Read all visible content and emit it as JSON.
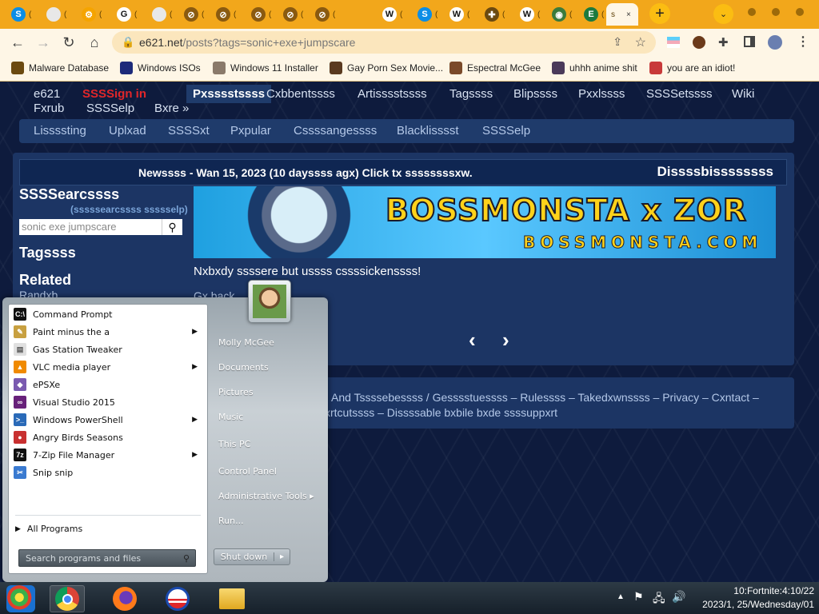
{
  "browser": {
    "tabs": [
      {
        "icon": "skype-icon",
        "color": "#0b8de6",
        "glyph": "S"
      },
      {
        "icon": "slides-icon",
        "color": "#e8e8e8",
        "glyph": ""
      },
      {
        "icon": "settings-icon",
        "color": "#f5a400",
        "glyph": "⚙"
      },
      {
        "icon": "google-icon",
        "color": "#ffffff",
        "glyph": "G"
      },
      {
        "icon": "slides-icon",
        "color": "#e8e8e8",
        "glyph": ""
      },
      {
        "icon": "blocked-icon",
        "color": "#8a5a10",
        "glyph": "⊘"
      },
      {
        "icon": "blocked-icon",
        "color": "#8a5a10",
        "glyph": "⊘"
      },
      {
        "icon": "blocked-icon",
        "color": "#8a5a10",
        "glyph": "⊘"
      },
      {
        "icon": "blocked-icon",
        "color": "#8a5a10",
        "glyph": "⊘"
      },
      {
        "icon": "blocked-icon",
        "color": "#8a5a10",
        "glyph": "⊘"
      },
      {
        "icon": "wikipedia-icon",
        "color": "#ffffff",
        "glyph": "W"
      },
      {
        "icon": "skype-icon",
        "color": "#0b8de6",
        "glyph": "S"
      },
      {
        "icon": "wikipedia-icon",
        "color": "#ffffff",
        "glyph": "W"
      },
      {
        "icon": "extension-icon",
        "color": "#6b4a10",
        "glyph": "✚"
      },
      {
        "icon": "wikipedia-icon",
        "color": "#ffffff",
        "glyph": "W"
      },
      {
        "icon": "globe-icon",
        "color": "#3b7a3b",
        "glyph": "◉"
      },
      {
        "icon": "excel-icon",
        "color": "#1d7a3e",
        "glyph": "E"
      }
    ],
    "active_tab_label": "s",
    "tab_close": "×",
    "tab_dots": "(",
    "url_host": "e621.net",
    "url_path": "/posts?tags=sonic+exe+jumpscare",
    "bookmarks": [
      {
        "label": "Malware Database",
        "icon": "bug-icon",
        "color": "#6b4a10"
      },
      {
        "label": "Windows ISOs",
        "icon": "x-icon",
        "color": "#1c2a7a"
      },
      {
        "label": "Windows 11 Installer",
        "icon": "cat-icon",
        "color": "#8a7a6a"
      },
      {
        "label": "Gay Porn Sex Movie...",
        "icon": "face-icon",
        "color": "#5a3a20"
      },
      {
        "label": "Espectral McGee",
        "icon": "avatar-icon",
        "color": "#7a4a2a"
      },
      {
        "label": "uhhh anime shit",
        "icon": "anime-icon",
        "color": "#4a3a5a"
      },
      {
        "label": "you are an idiot!",
        "icon": "flag-icon",
        "color": "#c83a3a"
      }
    ]
  },
  "site": {
    "nav_row1": [
      "e621",
      "SSSSign in",
      "Pxsssstssss",
      "Cxbbentssss",
      "Artisssstssss",
      "Tagssss",
      "Blipssss",
      "Pxxlssss",
      "SSSSetssss",
      "Wiki"
    ],
    "nav_row2": [
      "Fxrub",
      "SSSSelp",
      "Bxre »"
    ],
    "subnav": [
      "Lissssting",
      "Uplxad",
      "SSSSxt",
      "Pxpular",
      "Cssssangessss",
      "Blacklisssst",
      "SSSSelp"
    ],
    "news": "Newssss - Wan 15, 2023 (10 dayssss agx) Click tx ssssssssxw.",
    "dismiss": "Dissssbissssssss",
    "search_title": "SSSSearcssss",
    "search_help": "(sssssearcssss ssssselp)",
    "search_value": "sonic exe jumpscare",
    "tags_title": "Tagssss",
    "related_title": "Related",
    "related_link": "Randxb",
    "banner_title": "BOSSMONSTA x ZOR",
    "banner_sub": "BOSSMONSTA.COM",
    "nobody_text": "Nxbxdy ssssere but ussss cssssickenssss!",
    "go_back": "Gx back",
    "prev_arrow": "‹",
    "next_arrow": "›",
    "footer_line1": "And Tssssebessss / Gesssstuessss – Rulessss – Takedxwnssss – Privacy – Cxntact –",
    "footer_line2": "xrtcutssss – Dissssable bxbile bxde ssssuppxrt"
  },
  "startmenu": {
    "programs": [
      {
        "label": "Command Prompt",
        "icon": "cmd-icon",
        "color": "#111111",
        "glyph": "C:\\",
        "arrow": false
      },
      {
        "label": "Paint minus the a",
        "icon": "paint-icon",
        "color": "#c8a040",
        "glyph": "✎",
        "arrow": true
      },
      {
        "label": "Gas Station Tweaker",
        "icon": "document-icon",
        "color": "#e0e0e0",
        "glyph": "▤",
        "arrow": false
      },
      {
        "label": "VLC media player",
        "icon": "vlc-icon",
        "color": "#f08a00",
        "glyph": "▲",
        "arrow": true
      },
      {
        "label": "ePSXe",
        "icon": "epsxe-icon",
        "color": "#7a5ab0",
        "glyph": "◆",
        "arrow": false
      },
      {
        "label": "Visual Studio 2015",
        "icon": "visual-studio-icon",
        "color": "#68217a",
        "glyph": "∞",
        "arrow": false
      },
      {
        "label": "Windows PowerShell",
        "icon": "powershell-icon",
        "color": "#2a6ab8",
        "glyph": ">_",
        "arrow": true
      },
      {
        "label": "Angry Birds Seasons",
        "icon": "angry-birds-icon",
        "color": "#c83030",
        "glyph": "●",
        "arrow": false
      },
      {
        "label": "7-Zip File Manager",
        "icon": "7zip-icon",
        "color": "#111111",
        "glyph": "7z",
        "arrow": true
      },
      {
        "label": "Snip snip",
        "icon": "snipping-icon",
        "color": "#3a7ad0",
        "glyph": "✂",
        "arrow": false
      }
    ],
    "all_programs": "All Programs",
    "search_placeholder": "Search programs and files",
    "right_items": [
      "Molly McGee",
      "Documents",
      "Pictures",
      "Music",
      "This PC",
      "Control Panel",
      "Administrative Tools",
      "Run..."
    ],
    "shutdown": "Shut down",
    "shutdown_arrow": "▸"
  },
  "taskbar": {
    "clock_time": "10:Fortnite:4:10/22",
    "clock_date": "2023/1, 25/Wednesday/01",
    "tray_chevron": "▲",
    "tray_flag": "⚑",
    "tray_network": "🖧",
    "tray_volume": "🔊"
  }
}
